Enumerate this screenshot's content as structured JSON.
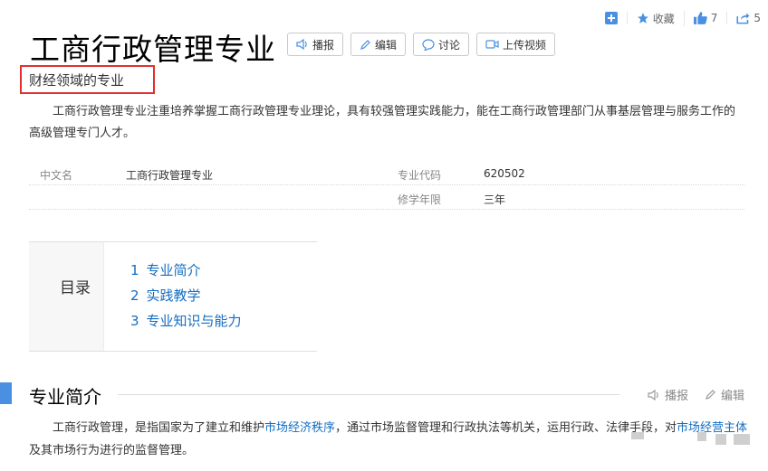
{
  "toolbar": {
    "collect_label": "收藏",
    "like_count": "7",
    "share_count": "5"
  },
  "page": {
    "title": "工商行政管理专业",
    "subtitle": "财经领域的专业"
  },
  "actions": {
    "play": "播报",
    "edit": "编辑",
    "discuss": "讨论",
    "upload_video": "上传视频"
  },
  "summary": "工商行政管理专业注重培养掌握工商行政管理专业理论，具有较强管理实践能力，能在工商行政管理部门从事基层管理与服务工作的高级管理专门人才。",
  "info": {
    "cn_name_label": "中文名",
    "cn_name_value": "工商行政管理专业",
    "code_label": "专业代码",
    "code_value": "620502",
    "duration_label": "修学年限",
    "duration_value": "三年"
  },
  "toc": {
    "label": "目录",
    "items": [
      {
        "num": "1",
        "text": "专业简介"
      },
      {
        "num": "2",
        "text": "实践教学"
      },
      {
        "num": "3",
        "text": "专业知识与能力"
      }
    ]
  },
  "section": {
    "title": "专业简介",
    "play": "播报",
    "edit": "编辑"
  },
  "paragraph": {
    "part1": "工商行政管理，是指国家为了建立和维护",
    "link1": "市场经济秩序",
    "part2": "，通过市场监督管理和行政执法等机关，运用行政、法律手段，对",
    "link2": "市场经营主体",
    "part3": "及其市场行为进行的监督管理。"
  },
  "colors": {
    "accent": "#4a90e2",
    "link": "#136ec2",
    "highlight_border": "#e03030"
  }
}
